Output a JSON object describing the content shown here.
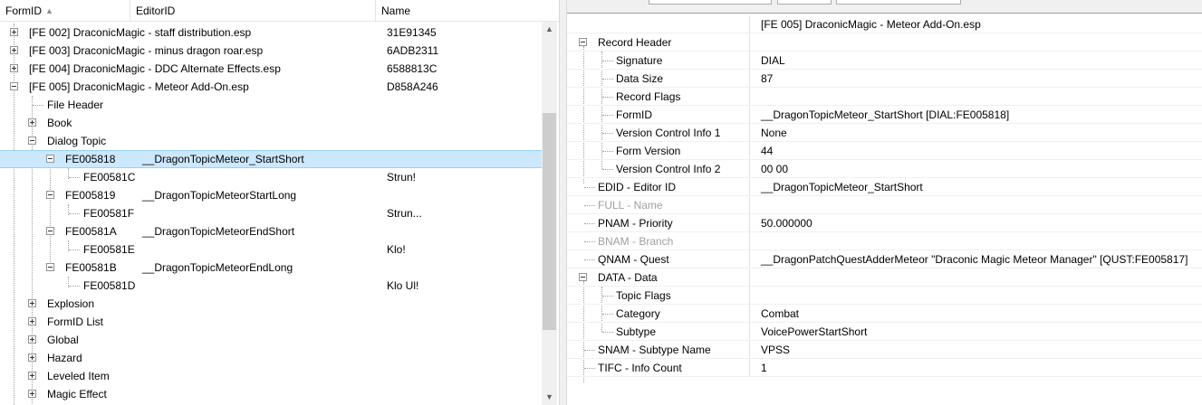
{
  "left_header": {
    "formid": "FormID",
    "editorid": "EditorID",
    "name": "Name"
  },
  "tree": {
    "plugins": [
      {
        "formid": "[FE 002] DraconicMagic - staff distribution.esp",
        "name": "31E91345"
      },
      {
        "formid": "[FE 003] DraconicMagic - minus dragon roar.esp",
        "name": "6ADB2311"
      },
      {
        "formid": "[FE 004] DraconicMagic - DDC Alternate Effects.esp",
        "name": "6588813C"
      },
      {
        "formid": "[FE 005] DraconicMagic - Meteor Add-On.esp",
        "name": "D858A246"
      }
    ],
    "groups_top": [
      "File Header",
      "Book",
      "Dialog Topic"
    ],
    "topics": [
      {
        "formid": "FE005818",
        "editorid": "__DragonTopicMeteor_StartShort",
        "info": {
          "formid": "FE00581C",
          "name": "Strun!"
        }
      },
      {
        "formid": "FE005819",
        "editorid": "__DragonTopicMeteorStartLong",
        "info": {
          "formid": "FE00581F",
          "name": "Strun..."
        }
      },
      {
        "formid": "FE00581A",
        "editorid": "__DragonTopicMeteorEndShort",
        "info": {
          "formid": "FE00581E",
          "name": "Klo!"
        }
      },
      {
        "formid": "FE00581B",
        "editorid": "__DragonTopicMeteorEndLong",
        "info": {
          "formid": "FE00581D",
          "name": "Klo Ul!"
        }
      }
    ],
    "groups_bottom": [
      "Explosion",
      "FormID List",
      "Global",
      "Hazard",
      "Leveled Item",
      "Magic Effect"
    ]
  },
  "record": {
    "title": "[FE 005] DraconicMagic - Meteor Add-On.esp",
    "header_label": "Record Header",
    "header_fields": [
      {
        "label": "Signature",
        "value": "DIAL"
      },
      {
        "label": "Data Size",
        "value": "87"
      },
      {
        "label": "Record Flags",
        "value": ""
      },
      {
        "label": "FormID",
        "value": "__DragonTopicMeteor_StartShort [DIAL:FE005818]"
      },
      {
        "label": "Version Control Info 1",
        "value": "None"
      },
      {
        "label": "Form Version",
        "value": "44"
      },
      {
        "label": "Version Control Info 2",
        "value": "00 00"
      }
    ],
    "edid": {
      "label": "EDID - Editor ID",
      "value": "__DragonTopicMeteor_StartShort"
    },
    "full": {
      "label": "FULL - Name",
      "value": ""
    },
    "pnam": {
      "label": "PNAM - Priority",
      "value": "50.000000"
    },
    "bnam": {
      "label": "BNAM - Branch",
      "value": ""
    },
    "qnam": {
      "label": "QNAM - Quest",
      "value": "__DragonPatchQuestAdderMeteor \"Draconic Magic Meteor Manager\" [QUST:FE005817]"
    },
    "data_label": "DATA - Data",
    "data_fields": [
      {
        "label": "Topic Flags",
        "value": ""
      },
      {
        "label": "Category",
        "value": "Combat"
      },
      {
        "label": "Subtype",
        "value": "VoicePowerStartShort"
      }
    ],
    "snam": {
      "label": "SNAM - Subtype Name",
      "value": "VPSS"
    },
    "tifc": {
      "label": "TIFC - Info Count",
      "value": "1"
    }
  },
  "scrollbar": {
    "up_glyph": "▲",
    "down_glyph": "▼"
  }
}
